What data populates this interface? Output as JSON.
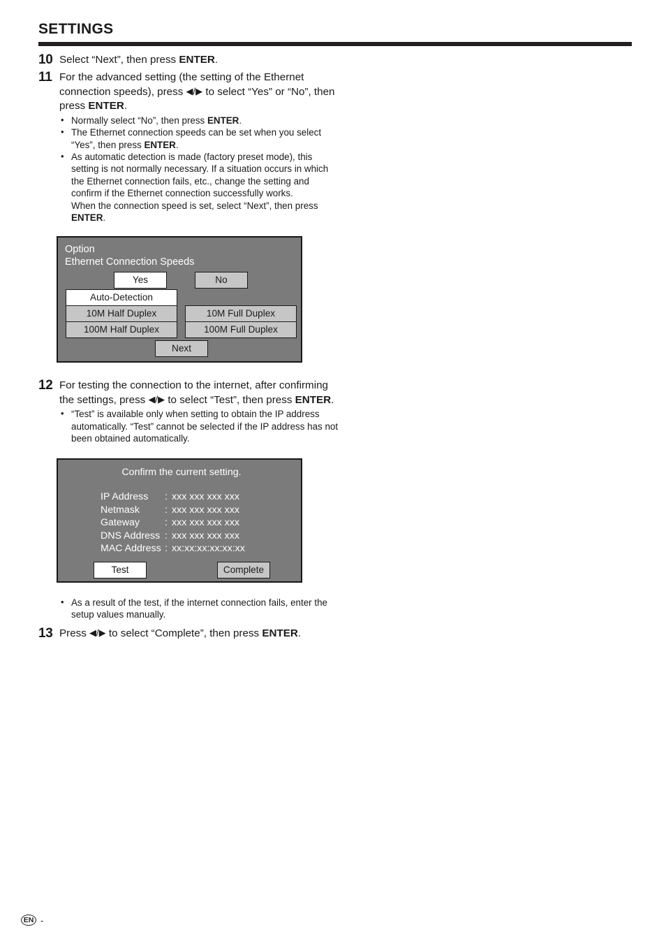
{
  "header": {
    "title": "SETTINGS"
  },
  "steps": [
    {
      "number": "10",
      "text_parts": [
        {
          "t": "Select “Next”, then press ",
          "b": false
        },
        {
          "t": "ENTER",
          "b": true
        },
        {
          "t": ".",
          "b": false
        }
      ],
      "line1": "Select “Next”, then press ",
      "bold1": "ENTER",
      "line1_end": "."
    },
    {
      "number": "11",
      "seg_a": "For the advanced setting (the setting of the Ethernet connection speeds), press ",
      "arrows": "◀/▶",
      "seg_b": " to select “Yes” or “No”, then press ",
      "bold_enter": "ENTER",
      "seg_c": ".",
      "bullets": [
        {
          "seg_a": "Normally select “No”, then press ",
          "bold": "ENTER",
          "seg_b": "."
        },
        {
          "seg_a": "The Ethernet connection speeds can be set when you select “Yes”, then press ",
          "bold": "ENTER",
          "seg_b": "."
        },
        {
          "seg_a": "As automatic detection is made (factory preset mode), this setting is not normally necessary. If a situation occurs in which the Ethernet connection fails, etc., change the setting and confirm if the Ethernet connection successfully works.",
          "cont_a": "When the connection speed is set, select “Next”, then press ",
          "bold": "ENTER",
          "seg_b": "."
        }
      ]
    },
    {
      "number": "12",
      "seg_a": "For testing the connection to the internet, after confirming the settings, press ",
      "arrows": "◀/▶",
      "seg_b": " to select “Test”, then press ",
      "bold_enter": "ENTER",
      "seg_c": ".",
      "bullets": [
        {
          "seg_a": "“Test” is available only when setting to obtain the IP address automatically. “Test” cannot be selected if the IP address has not been obtained automatically."
        }
      ]
    },
    {
      "number": "13",
      "seg_a": "Press ",
      "arrows": "◀/▶",
      "seg_b": " to select “Complete”, then press ",
      "bold_enter": "ENTER",
      "seg_c": "."
    }
  ],
  "post_test_bullet": {
    "seg_a": "As a result of the test, if the internet connection fails, enter the setup values manually."
  },
  "osd_speeds": {
    "title_line1": "Option",
    "title_line2": "Ethernet Connection Speeds",
    "buttons": {
      "yes": "Yes",
      "no": "No",
      "auto_detection": "Auto-Detection",
      "m10_half": "10M Half Duplex",
      "m10_full": "10M Full Duplex",
      "m100_half": "100M Half Duplex",
      "m100_full": "100M Full Duplex",
      "next": "Next"
    },
    "selected": [
      "Yes",
      "Auto-Detection"
    ],
    "colors": {
      "dialog_bg": "#7b7b7b",
      "button_bg": "#c6c6c6",
      "button_selected_bg": "#ffffff",
      "border": "#171717",
      "title_text": "#ffffff"
    }
  },
  "osd_confirm": {
    "heading": "Confirm the current setting.",
    "rows": [
      {
        "label": "IP Address",
        "sep": ":",
        "value": "xxx xxx xxx xxx"
      },
      {
        "label": "Netmask",
        "sep": ":",
        "value": "xxx xxx xxx xxx"
      },
      {
        "label": "Gateway",
        "sep": ":",
        "value": "xxx xxx xxx xxx"
      },
      {
        "label": "DNS Address",
        "sep": ":",
        "value": "xxx xxx xxx xxx"
      },
      {
        "label": "MAC Address",
        "sep": ":",
        "value": "xx:xx:xx:xx:xx:xx"
      }
    ],
    "buttons": {
      "test": "Test",
      "complete": "Complete"
    },
    "selected": [
      "Test"
    ]
  },
  "footer": {
    "language_badge": "EN",
    "page_dash": "-"
  }
}
